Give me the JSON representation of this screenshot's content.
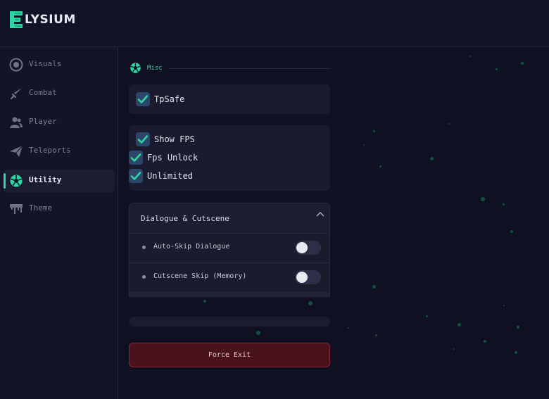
{
  "app": {
    "logo_letter": "E",
    "logo_text": "LYSIUM"
  },
  "sidebar": {
    "items": [
      {
        "label": "Visuals",
        "icon": "eye-icon",
        "active": false
      },
      {
        "label": "Combat",
        "icon": "sword-icon",
        "active": false
      },
      {
        "label": "Player",
        "icon": "users-icon",
        "active": false
      },
      {
        "label": "Teleports",
        "icon": "send-icon",
        "active": false
      },
      {
        "label": "Utility",
        "icon": "soccer-ball-icon",
        "active": true
      },
      {
        "label": "Theme",
        "icon": "paint-drip-icon",
        "active": false
      }
    ]
  },
  "main": {
    "section": {
      "label": "Misc",
      "icon": "soccer-ball-icon"
    },
    "panel1": {
      "items": [
        {
          "label": "TpSafe",
          "checked": true
        }
      ]
    },
    "panel2": {
      "items": [
        {
          "label": "Show FPS",
          "checked": true
        },
        {
          "label": "Fps Unlock",
          "checked": true
        },
        {
          "label": "Unlimited",
          "checked": true
        }
      ]
    },
    "dropdown": {
      "title": "Dialogue & Cutscene",
      "expanded": true,
      "items": [
        {
          "label": "Auto-Skip Dialogue",
          "enabled": false
        },
        {
          "label": "Cutscene Skip (Memory)",
          "enabled": false
        }
      ]
    },
    "force_exit_label": "Force Exit"
  },
  "colors": {
    "accent": "#2fd5a3",
    "background": "#0f1021",
    "panel": "#1a1b2e",
    "checkbox": "#2d4568",
    "danger": "#4a121b"
  }
}
